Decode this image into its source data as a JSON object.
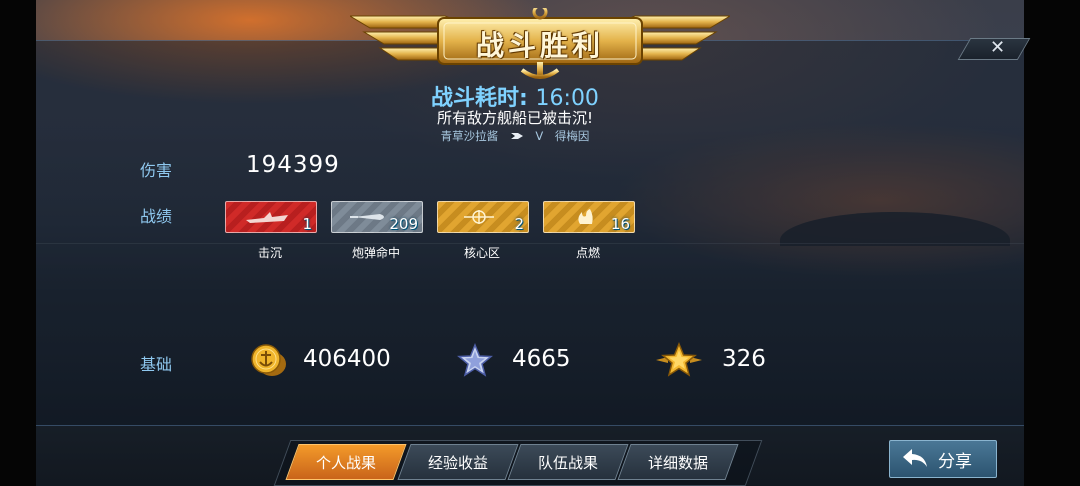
{
  "header": {
    "title": "战斗胜利",
    "close_label": "✕"
  },
  "battle": {
    "duration_label": "战斗耗时:",
    "duration_value": "16:00",
    "result_message": "所有敌方舰船已被击沉!",
    "player_left": "青草沙拉酱",
    "versus": "V",
    "player_right": "得梅因"
  },
  "stats": {
    "damage_label": "伤害",
    "damage_value": "194399",
    "achievements_label": "战绩",
    "medals": [
      {
        "name": "击沉",
        "count": "1",
        "color": "#d02a28",
        "icon": "sunk-ship-icon"
      },
      {
        "name": "炮弹命中",
        "count": "209",
        "color": "#7f8c99",
        "icon": "shell-hit-icon"
      },
      {
        "name": "核心区",
        "count": "2",
        "color": "#e1a530",
        "icon": "citadel-icon"
      },
      {
        "name": "点燃",
        "count": "16",
        "color": "#e1a530",
        "icon": "fire-icon"
      }
    ],
    "base_label": "基础",
    "rewards": [
      {
        "icon": "gold-coin-icon",
        "value": "406400"
      },
      {
        "icon": "silver-star-icon",
        "value": "4665"
      },
      {
        "icon": "gold-winged-star-icon",
        "value": "326"
      }
    ]
  },
  "tabs": [
    {
      "label": "个人战果",
      "active": true
    },
    {
      "label": "经验收益",
      "active": false
    },
    {
      "label": "队伍战果",
      "active": false
    },
    {
      "label": "详细数据",
      "active": false
    }
  ],
  "share_label": "分享",
  "colors": {
    "accent": "#f39a2a",
    "label_blue": "#8fc8ef",
    "duration_blue": "#7fd2ff"
  }
}
